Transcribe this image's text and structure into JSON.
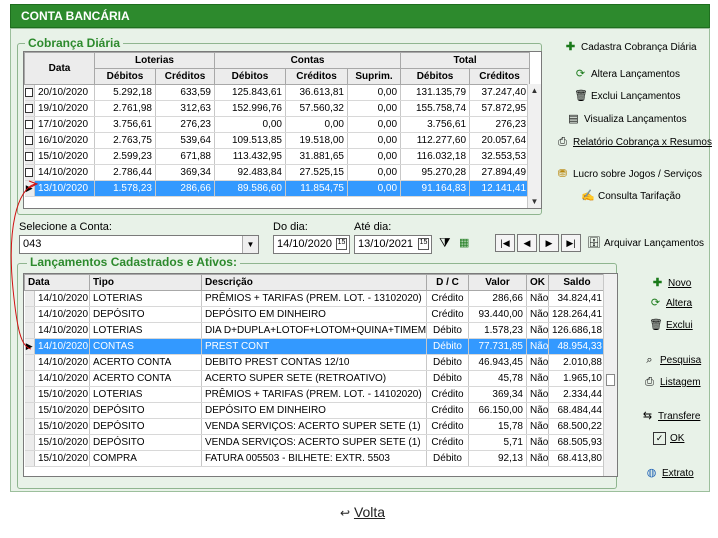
{
  "window": {
    "title": "CONTA BANCÁRIA"
  },
  "cobranca": {
    "legend": "Cobrança Diária",
    "group_headers": {
      "data": "Data",
      "loterias": "Loterias",
      "contas": "Contas",
      "total": "Total"
    },
    "columns": [
      "Débitos",
      "Créditos",
      "Débitos",
      "Créditos",
      "Suprim.",
      "Débitos",
      "Créditos"
    ],
    "rows": [
      [
        "20/10/2020",
        "5.292,18",
        "633,59",
        "125.843,61",
        "36.613,81",
        "0,00",
        "131.135,79",
        "37.247,40"
      ],
      [
        "19/10/2020",
        "2.761,98",
        "312,63",
        "152.996,76",
        "57.560,32",
        "0,00",
        "155.758,74",
        "57.872,95"
      ],
      [
        "17/10/2020",
        "3.756,61",
        "276,23",
        "0,00",
        "0,00",
        "0,00",
        "3.756,61",
        "276,23"
      ],
      [
        "16/10/2020",
        "2.763,75",
        "539,64",
        "109.513,85",
        "19.518,00",
        "0,00",
        "112.277,60",
        "20.057,64"
      ],
      [
        "15/10/2020",
        "2.599,23",
        "671,88",
        "113.432,95",
        "31.881,65",
        "0,00",
        "116.032,18",
        "32.553,53"
      ],
      [
        "14/10/2020",
        "2.786,44",
        "369,34",
        "92.483,84",
        "27.525,15",
        "0,00",
        "95.270,28",
        "27.894,49"
      ],
      [
        "13/10/2020",
        "1.578,23",
        "286,66",
        "89.586,60",
        "11.854,75",
        "0,00",
        "91.164,83",
        "12.141,41"
      ]
    ],
    "selected_index": 6
  },
  "side_actions": {
    "cadastra": "Cadastra Cobrança Diária",
    "altera": "Altera Lançamentos",
    "exclui": "Exclui Lançamentos",
    "visualiza": "Visualiza Lançamentos",
    "relatorio": "Relatório Cobrança x Resumos",
    "lucro": "Lucro sobre Jogos / Serviços",
    "tarifacao": "Consulta Tarifação"
  },
  "filters": {
    "conta_label": "Selecione a Conta:",
    "conta_value": "043",
    "do_dia_label": "Do dia:",
    "do_dia_value": "14/10/2020",
    "ate_dia_label": "Até dia:",
    "ate_dia_value": "13/10/2021",
    "arquivar": "Arquivar Lançamentos"
  },
  "lancamentos": {
    "legend": "Lançamentos Cadastrados e Ativos:",
    "columns": [
      "Data",
      "Tipo",
      "Descrição",
      "D / C",
      "Valor",
      "OK",
      "Saldo"
    ],
    "rows": [
      [
        "14/10/2020",
        "LOTERIAS",
        "PRÊMIOS + TARIFAS (PREM. LOT. - 13102020)",
        "Crédito",
        "286,66",
        "Não",
        "34.824,41"
      ],
      [
        "14/10/2020",
        "DEPÓSITO",
        "DEPÓSITO EM DINHEIRO",
        "Crédito",
        "93.440,00",
        "Não",
        "128.264,41"
      ],
      [
        "14/10/2020",
        "LOTERIAS",
        "DIA D+DUPLA+LOTOF+LOTOM+QUINA+TIMEM(ARR",
        "Débito",
        "1.578,23",
        "Não",
        "126.686,18"
      ],
      [
        "14/10/2020",
        "CONTAS",
        "PREST CONT",
        "Débito",
        "77.731,85",
        "Não",
        "48.954,33"
      ],
      [
        "14/10/2020",
        "ACERTO CONTA",
        "DEBITO PREST CONTAS 12/10",
        "Débito",
        "46.943,45",
        "Não",
        "2.010,88"
      ],
      [
        "14/10/2020",
        "ACERTO CONTA",
        "ACERTO SUPER SETE (RETROATIVO)",
        "Débito",
        "45,78",
        "Não",
        "1.965,10"
      ],
      [
        "15/10/2020",
        "LOTERIAS",
        "PRÊMIOS + TARIFAS (PREM. LOT. - 14102020)",
        "Crédito",
        "369,34",
        "Não",
        "2.334,44"
      ],
      [
        "15/10/2020",
        "DEPÓSITO",
        "DEPÓSITO EM DINHEIRO",
        "Crédito",
        "66.150,00",
        "Não",
        "68.484,44"
      ],
      [
        "15/10/2020",
        "DEPÓSITO",
        "VENDA SERVIÇOS: ACERTO SUPER SETE (1)",
        "Crédito",
        "15,78",
        "Não",
        "68.500,22"
      ],
      [
        "15/10/2020",
        "DEPÓSITO",
        "VENDA SERVIÇOS: ACERTO SUPER SETE (1)",
        "Crédito",
        "5,71",
        "Não",
        "68.505,93"
      ],
      [
        "15/10/2020",
        "COMPRA",
        "FATURA 005503 - BILHETE: EXTR. 5503",
        "Débito",
        "92,13",
        "Não",
        "68.413,80"
      ]
    ],
    "selected_index": 3
  },
  "right_actions": {
    "novo": "Novo",
    "altera": "Altera",
    "exclui": "Exclui",
    "pesquisa": "Pesquisa",
    "listagem": "Listagem",
    "transfere": "Transfere",
    "ok": "OK",
    "extrato": "Extrato"
  },
  "footer": {
    "volta": "Volta"
  }
}
